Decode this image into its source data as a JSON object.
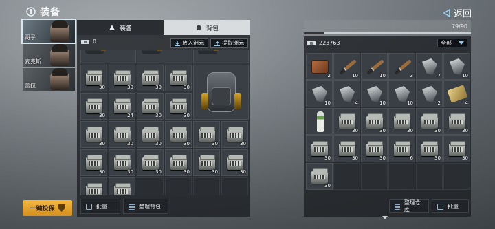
{
  "header": {
    "title": "装备",
    "back_label": "返回"
  },
  "characters": [
    {
      "name": "哥子",
      "active": true
    },
    {
      "name": "麦克斯",
      "active": false
    },
    {
      "name": "蕾拉",
      "active": false
    }
  ],
  "dump_button": "一键投保",
  "left_panel": {
    "tabs": [
      {
        "label": "装备",
        "icon": "gear-equip-icon",
        "active": false
      },
      {
        "label": "背包",
        "icon": "backpack-icon",
        "active": true
      }
    ],
    "money": "0",
    "put_button": "放入洲元",
    "take_button": "提取洲元",
    "items": [
      {
        "kind": "vest",
        "qty": ""
      },
      {
        "kind": "vest",
        "qty": ""
      },
      {
        "kind": "vest",
        "qty": ""
      },
      {
        "kind": "ammo",
        "qty": "30"
      },
      {
        "kind": "ammo",
        "qty": "30"
      },
      {
        "kind": "ammo",
        "qty": "30"
      },
      {
        "kind": "ammo",
        "qty": "30"
      },
      {
        "kind": "ammo",
        "qty": "30"
      },
      {
        "kind": "ammo",
        "qty": "24"
      },
      {
        "kind": "ammo",
        "qty": "30"
      },
      {
        "kind": "ammo",
        "qty": "30"
      },
      {
        "kind": "ammo",
        "qty": "30"
      },
      {
        "kind": "ammo",
        "qty": "30"
      },
      {
        "kind": "ammo",
        "qty": "30"
      },
      {
        "kind": "ammo",
        "qty": "30"
      },
      {
        "kind": "ammo",
        "qty": "30"
      },
      {
        "kind": "ammo",
        "qty": "30"
      },
      {
        "kind": "ammo",
        "qty": "30"
      },
      {
        "kind": "ammo",
        "qty": "30"
      },
      {
        "kind": "ammo",
        "qty": "30"
      },
      {
        "kind": "ammo",
        "qty": "30"
      },
      {
        "kind": "ammo",
        "qty": "30"
      },
      {
        "kind": "ammo",
        "qty": "30"
      },
      {
        "kind": "ammo",
        "qty": ""
      },
      {
        "kind": "ammo",
        "qty": ""
      }
    ],
    "batch_button": "批量",
    "sort_button": "整理背包"
  },
  "right_panel": {
    "capacity_text": "79/90",
    "capacity_fraction": 0.878,
    "money": "223763",
    "filter_label": "全部",
    "items": [
      {
        "kind": "wallet",
        "qty": "2"
      },
      {
        "kind": "bat",
        "qty": "10"
      },
      {
        "kind": "bat",
        "qty": "10"
      },
      {
        "kind": "bat",
        "qty": "3"
      },
      {
        "kind": "tool",
        "qty": "7"
      },
      {
        "kind": "tool",
        "qty": "10"
      },
      {
        "kind": "tool",
        "qty": "10"
      },
      {
        "kind": "tool",
        "qty": "4"
      },
      {
        "kind": "tool",
        "qty": "10"
      },
      {
        "kind": "tool",
        "qty": "10"
      },
      {
        "kind": "tool",
        "qty": "2"
      },
      {
        "kind": "card",
        "qty": "4"
      },
      {
        "kind": "spray",
        "qty": ""
      },
      {
        "kind": "ammo",
        "qty": "30"
      },
      {
        "kind": "ammo",
        "qty": "30"
      },
      {
        "kind": "ammo",
        "qty": "30"
      },
      {
        "kind": "ammo",
        "qty": "30"
      },
      {
        "kind": "ammo",
        "qty": "30"
      },
      {
        "kind": "ammo",
        "qty": "30"
      },
      {
        "kind": "ammo",
        "qty": "30"
      },
      {
        "kind": "ammo",
        "qty": "30"
      },
      {
        "kind": "ammo",
        "qty": "6"
      },
      {
        "kind": "ammo",
        "qty": "30"
      },
      {
        "kind": "ammo",
        "qty": "30"
      },
      {
        "kind": "ammo",
        "qty": "30"
      }
    ],
    "sort_button": "整理仓库",
    "batch_button": "批量"
  }
}
